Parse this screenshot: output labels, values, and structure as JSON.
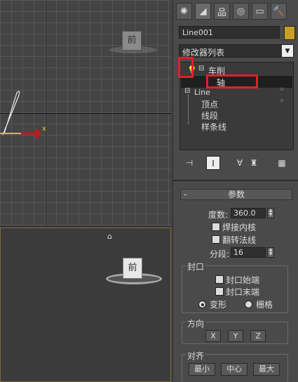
{
  "viewport_top": {
    "cube_label": "前",
    "axis_x": "x"
  },
  "viewport_persp": {
    "cube_label": "前",
    "home": "⌂"
  },
  "panel": {
    "tabs": [
      {
        "name": "create",
        "glyph": "✺"
      },
      {
        "name": "modify",
        "glyph": "◢"
      },
      {
        "name": "hierarchy",
        "glyph": "品"
      },
      {
        "name": "motion",
        "glyph": "◎"
      },
      {
        "name": "display",
        "glyph": "▭"
      },
      {
        "name": "utilities",
        "glyph": "🔨"
      }
    ],
    "object_name": "Line001",
    "modifier_list": "修改器列表",
    "stack": {
      "lathe": "车削",
      "axis": "轴",
      "line": "Line",
      "vertex": "顶点",
      "segment": "线段",
      "spline": "样条线"
    },
    "highlight_color": "#e0202a"
  },
  "params": {
    "title": "参数",
    "collapse": "-",
    "degrees_label": "度数:",
    "degrees_value": "360.0",
    "weld_core": "焊接内核",
    "flip_normals": "翻转法线",
    "segments_label": "分段:",
    "segments_value": "16",
    "capping": {
      "title": "封口",
      "cap_start": "封口始端",
      "cap_end": "封口末端",
      "morph": "变形",
      "grid": "栅格"
    },
    "direction": {
      "title": "方向",
      "x": "X",
      "y": "Y",
      "z": "Z"
    },
    "align": {
      "title": "对齐",
      "min": "最小",
      "center": "中心",
      "max": "最大"
    }
  }
}
